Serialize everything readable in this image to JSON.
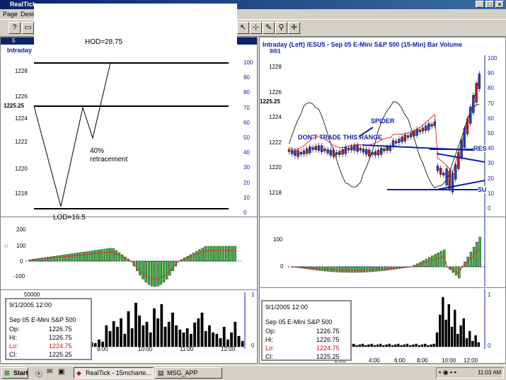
{
  "window": {
    "title": "RealTick"
  },
  "menu": [
    "Page",
    "Design"
  ],
  "left_panel": {
    "tab_label": "5",
    "header": "Intraday",
    "price_ticks": [
      "1228",
      "1226",
      "1224",
      "1222",
      "1220",
      "1218"
    ],
    "current_price": "1225.25",
    "osc_ticks": [
      "100",
      "90",
      "80",
      "70",
      "60",
      "50",
      "40",
      "30",
      "20",
      "10",
      "0"
    ],
    "macd_ticks": [
      "200",
      "100",
      "0",
      "-100"
    ],
    "volume_top": "50000",
    "volume_right": [
      "1",
      "0"
    ],
    "time_axis": [
      "9:00",
      "10:00",
      "11:00",
      "12:00"
    ]
  },
  "right_panel": {
    "header": "Intraday   (Left)   /ESU5 - Sep 05  E-Mini S&P 500   (15-Min)   Bar  Volume",
    "date_label": "9/01",
    "price_ticks": [
      "1228",
      "1226",
      "1224",
      "1222",
      "1220",
      "1218"
    ],
    "current_price": "1225.25",
    "osc_ticks": [
      "100",
      "90",
      "80",
      "70",
      "60",
      "50",
      "40",
      "30",
      "20",
      "10",
      "0"
    ],
    "macd_ticks": [
      "100",
      "0"
    ],
    "volume_right": [
      "1",
      "0"
    ],
    "time_axis": [
      "2:00",
      "4:00",
      "6:00",
      "8:00",
      "10:00",
      "12:00"
    ],
    "annotations": {
      "spider": "SPIDER",
      "range": "DON'T TRADE THIS RANGE",
      "res": "RES",
      "sup": "SU"
    }
  },
  "overlay": {
    "hod": "HOD=28.75",
    "lod": "LOD=16.5",
    "retracement_pct": "40%",
    "retracement_word": "retracement"
  },
  "info_left": {
    "datetime": "9/1/2005 12:00",
    "symbol": "Sep 05  E-Mini S&P 500",
    "rows": [
      {
        "label": "Op:",
        "value": "1226.75"
      },
      {
        "label": "Hi:",
        "value": "1226.75"
      },
      {
        "label": "Lo:",
        "value": "1224.75"
      },
      {
        "label": "Cl:",
        "value": "1225.25"
      }
    ]
  },
  "info_right": {
    "datetime": "9/1/2005 12:00",
    "symbol": "Sep 05  E-Mini S&P 500",
    "rows": [
      {
        "label": "Op:",
        "value": "1226.75"
      },
      {
        "label": "Hi:",
        "value": "1226.75"
      },
      {
        "label": "Lo:",
        "value": "1224.75"
      },
      {
        "label": "Cl:",
        "value": "1225.25"
      }
    ]
  },
  "taskbar": {
    "start": "Start",
    "items": [
      "RealTick - 15mcharte...",
      "MSG_APP"
    ],
    "clock": "11:03 AM"
  },
  "colors": {
    "accent": "#1020b0",
    "up": "#2ea02e",
    "down": "#b01010"
  }
}
